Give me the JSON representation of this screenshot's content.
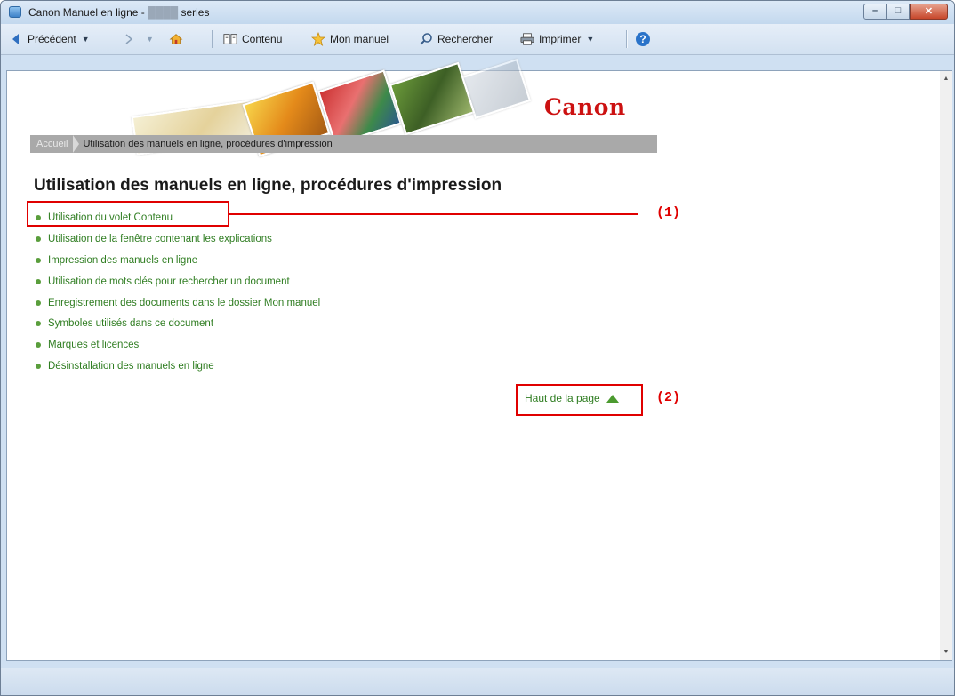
{
  "window": {
    "title_prefix": "Canon Manuel en ligne - ",
    "title_redacted": "████",
    "title_suffix": " series",
    "minimize_glyph": "–",
    "maximize_glyph": "□",
    "close_glyph": "✕"
  },
  "toolbar": {
    "back_label": "Précédent",
    "back_icon": "back-arrow-icon",
    "contents_label": "Contenu",
    "my_manual_label": "Mon manuel",
    "search_label": "Rechercher",
    "print_label": "Imprimer",
    "dropdown_glyph": "▼",
    "help_glyph": "?"
  },
  "page": {
    "logo": "Canon",
    "breadcrumb": {
      "home": "Accueil",
      "current": "Utilisation des manuels en ligne, procédures d'impression"
    },
    "title": "Utilisation des manuels en ligne, procédures d'impression",
    "links": [
      "Utilisation du volet Contenu",
      "Utilisation de la fenêtre contenant les explications",
      "Impression des manuels en ligne",
      "Utilisation de mots clés pour rechercher un document",
      "Enregistrement des documents dans le dossier Mon manuel",
      "Symboles utilisés dans ce document",
      "Marques et licences",
      "Désinstallation des manuels en ligne"
    ],
    "top_link": "Haut de la page"
  },
  "annotations": {
    "callout_1": "(1)",
    "callout_2": "(2)",
    "color": "#e00000"
  },
  "colors": {
    "link_green": "#2f7d21",
    "canon_red": "#cc1111",
    "breadcrumb_gray": "#a9a9a9"
  }
}
